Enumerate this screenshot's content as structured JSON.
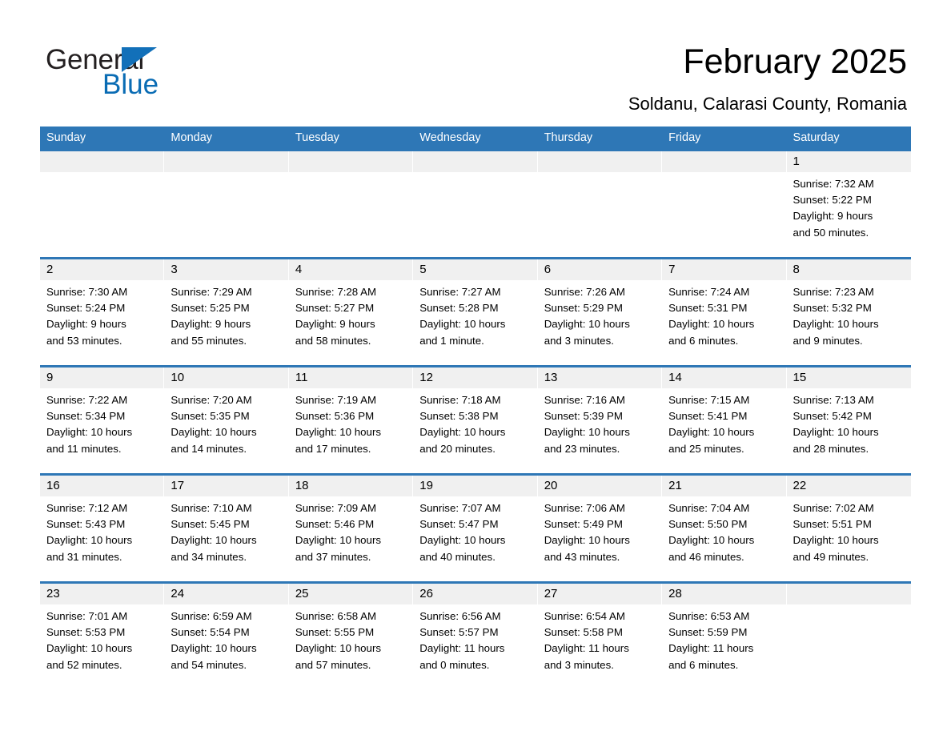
{
  "logo": {
    "word_one": "General",
    "word_two": "Blue",
    "triangle_icon": "blue-triangle-icon",
    "brand_blue": "#0a6cb4"
  },
  "header": {
    "month_title": "February 2025",
    "location": "Soldanu, Calarasi County, Romania"
  },
  "theme": {
    "header_blue": "#2e77b6",
    "day_band_gray": "#f0f0f0",
    "text_black": "#000000"
  },
  "calendar": {
    "day_headers": [
      "Sunday",
      "Monday",
      "Tuesday",
      "Wednesday",
      "Thursday",
      "Friday",
      "Saturday"
    ],
    "weeks": [
      [
        {
          "day": "",
          "sunrise": "",
          "sunset": "",
          "daylight_line1": "",
          "daylight_line2": ""
        },
        {
          "day": "",
          "sunrise": "",
          "sunset": "",
          "daylight_line1": "",
          "daylight_line2": ""
        },
        {
          "day": "",
          "sunrise": "",
          "sunset": "",
          "daylight_line1": "",
          "daylight_line2": ""
        },
        {
          "day": "",
          "sunrise": "",
          "sunset": "",
          "daylight_line1": "",
          "daylight_line2": ""
        },
        {
          "day": "",
          "sunrise": "",
          "sunset": "",
          "daylight_line1": "",
          "daylight_line2": ""
        },
        {
          "day": "",
          "sunrise": "",
          "sunset": "",
          "daylight_line1": "",
          "daylight_line2": ""
        },
        {
          "day": "1",
          "sunrise": "Sunrise: 7:32 AM",
          "sunset": "Sunset: 5:22 PM",
          "daylight_line1": "Daylight: 9 hours",
          "daylight_line2": "and 50 minutes."
        }
      ],
      [
        {
          "day": "2",
          "sunrise": "Sunrise: 7:30 AM",
          "sunset": "Sunset: 5:24 PM",
          "daylight_line1": "Daylight: 9 hours",
          "daylight_line2": "and 53 minutes."
        },
        {
          "day": "3",
          "sunrise": "Sunrise: 7:29 AM",
          "sunset": "Sunset: 5:25 PM",
          "daylight_line1": "Daylight: 9 hours",
          "daylight_line2": "and 55 minutes."
        },
        {
          "day": "4",
          "sunrise": "Sunrise: 7:28 AM",
          "sunset": "Sunset: 5:27 PM",
          "daylight_line1": "Daylight: 9 hours",
          "daylight_line2": "and 58 minutes."
        },
        {
          "day": "5",
          "sunrise": "Sunrise: 7:27 AM",
          "sunset": "Sunset: 5:28 PM",
          "daylight_line1": "Daylight: 10 hours",
          "daylight_line2": "and 1 minute."
        },
        {
          "day": "6",
          "sunrise": "Sunrise: 7:26 AM",
          "sunset": "Sunset: 5:29 PM",
          "daylight_line1": "Daylight: 10 hours",
          "daylight_line2": "and 3 minutes."
        },
        {
          "day": "7",
          "sunrise": "Sunrise: 7:24 AM",
          "sunset": "Sunset: 5:31 PM",
          "daylight_line1": "Daylight: 10 hours",
          "daylight_line2": "and 6 minutes."
        },
        {
          "day": "8",
          "sunrise": "Sunrise: 7:23 AM",
          "sunset": "Sunset: 5:32 PM",
          "daylight_line1": "Daylight: 10 hours",
          "daylight_line2": "and 9 minutes."
        }
      ],
      [
        {
          "day": "9",
          "sunrise": "Sunrise: 7:22 AM",
          "sunset": "Sunset: 5:34 PM",
          "daylight_line1": "Daylight: 10 hours",
          "daylight_line2": "and 11 minutes."
        },
        {
          "day": "10",
          "sunrise": "Sunrise: 7:20 AM",
          "sunset": "Sunset: 5:35 PM",
          "daylight_line1": "Daylight: 10 hours",
          "daylight_line2": "and 14 minutes."
        },
        {
          "day": "11",
          "sunrise": "Sunrise: 7:19 AM",
          "sunset": "Sunset: 5:36 PM",
          "daylight_line1": "Daylight: 10 hours",
          "daylight_line2": "and 17 minutes."
        },
        {
          "day": "12",
          "sunrise": "Sunrise: 7:18 AM",
          "sunset": "Sunset: 5:38 PM",
          "daylight_line1": "Daylight: 10 hours",
          "daylight_line2": "and 20 minutes."
        },
        {
          "day": "13",
          "sunrise": "Sunrise: 7:16 AM",
          "sunset": "Sunset: 5:39 PM",
          "daylight_line1": "Daylight: 10 hours",
          "daylight_line2": "and 23 minutes."
        },
        {
          "day": "14",
          "sunrise": "Sunrise: 7:15 AM",
          "sunset": "Sunset: 5:41 PM",
          "daylight_line1": "Daylight: 10 hours",
          "daylight_line2": "and 25 minutes."
        },
        {
          "day": "15",
          "sunrise": "Sunrise: 7:13 AM",
          "sunset": "Sunset: 5:42 PM",
          "daylight_line1": "Daylight: 10 hours",
          "daylight_line2": "and 28 minutes."
        }
      ],
      [
        {
          "day": "16",
          "sunrise": "Sunrise: 7:12 AM",
          "sunset": "Sunset: 5:43 PM",
          "daylight_line1": "Daylight: 10 hours",
          "daylight_line2": "and 31 minutes."
        },
        {
          "day": "17",
          "sunrise": "Sunrise: 7:10 AM",
          "sunset": "Sunset: 5:45 PM",
          "daylight_line1": "Daylight: 10 hours",
          "daylight_line2": "and 34 minutes."
        },
        {
          "day": "18",
          "sunrise": "Sunrise: 7:09 AM",
          "sunset": "Sunset: 5:46 PM",
          "daylight_line1": "Daylight: 10 hours",
          "daylight_line2": "and 37 minutes."
        },
        {
          "day": "19",
          "sunrise": "Sunrise: 7:07 AM",
          "sunset": "Sunset: 5:47 PM",
          "daylight_line1": "Daylight: 10 hours",
          "daylight_line2": "and 40 minutes."
        },
        {
          "day": "20",
          "sunrise": "Sunrise: 7:06 AM",
          "sunset": "Sunset: 5:49 PM",
          "daylight_line1": "Daylight: 10 hours",
          "daylight_line2": "and 43 minutes."
        },
        {
          "day": "21",
          "sunrise": "Sunrise: 7:04 AM",
          "sunset": "Sunset: 5:50 PM",
          "daylight_line1": "Daylight: 10 hours",
          "daylight_line2": "and 46 minutes."
        },
        {
          "day": "22",
          "sunrise": "Sunrise: 7:02 AM",
          "sunset": "Sunset: 5:51 PM",
          "daylight_line1": "Daylight: 10 hours",
          "daylight_line2": "and 49 minutes."
        }
      ],
      [
        {
          "day": "23",
          "sunrise": "Sunrise: 7:01 AM",
          "sunset": "Sunset: 5:53 PM",
          "daylight_line1": "Daylight: 10 hours",
          "daylight_line2": "and 52 minutes."
        },
        {
          "day": "24",
          "sunrise": "Sunrise: 6:59 AM",
          "sunset": "Sunset: 5:54 PM",
          "daylight_line1": "Daylight: 10 hours",
          "daylight_line2": "and 54 minutes."
        },
        {
          "day": "25",
          "sunrise": "Sunrise: 6:58 AM",
          "sunset": "Sunset: 5:55 PM",
          "daylight_line1": "Daylight: 10 hours",
          "daylight_line2": "and 57 minutes."
        },
        {
          "day": "26",
          "sunrise": "Sunrise: 6:56 AM",
          "sunset": "Sunset: 5:57 PM",
          "daylight_line1": "Daylight: 11 hours",
          "daylight_line2": "and 0 minutes."
        },
        {
          "day": "27",
          "sunrise": "Sunrise: 6:54 AM",
          "sunset": "Sunset: 5:58 PM",
          "daylight_line1": "Daylight: 11 hours",
          "daylight_line2": "and 3 minutes."
        },
        {
          "day": "28",
          "sunrise": "Sunrise: 6:53 AM",
          "sunset": "Sunset: 5:59 PM",
          "daylight_line1": "Daylight: 11 hours",
          "daylight_line2": "and 6 minutes."
        },
        {
          "day": "",
          "sunrise": "",
          "sunset": "",
          "daylight_line1": "",
          "daylight_line2": ""
        }
      ]
    ]
  }
}
